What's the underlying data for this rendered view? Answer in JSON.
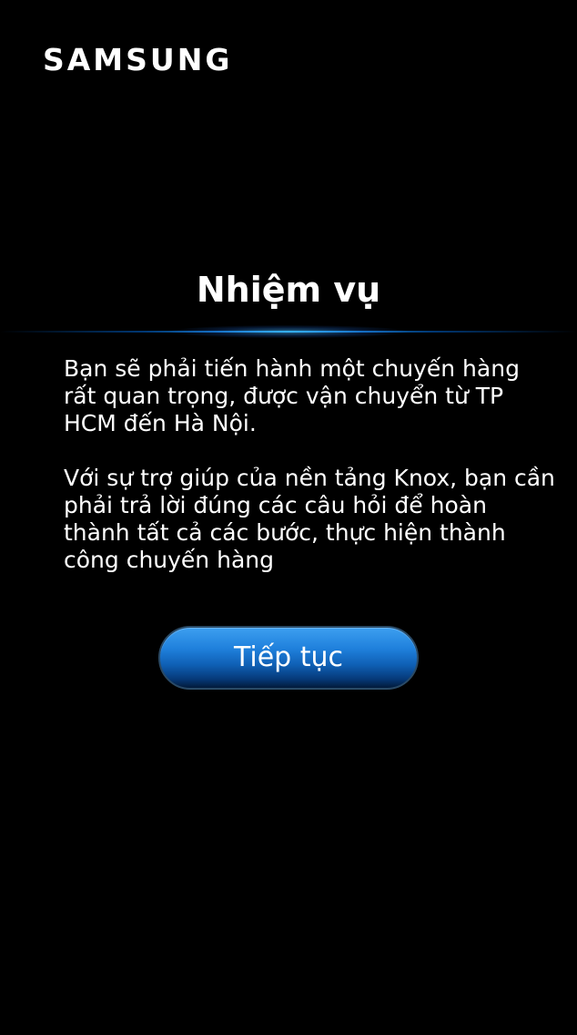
{
  "brand": {
    "logo_text": "SAMSUNG"
  },
  "heading": {
    "title": "Nhiệm vụ"
  },
  "content": {
    "paragraphs": [
      "Bạn sẽ phải tiến hành một chuyến hàng rất quan trọng, được vận chuyển từ TP HCM đến Hà Nội.",
      "Với sự trợ giúp của nền tảng Knox, bạn cần phải trả lời đúng các câu hỏi để hoàn thành tất cả các bước, thực hiện thành công chuyến hàng"
    ]
  },
  "actions": {
    "continue_label": "Tiếp tục"
  },
  "colors": {
    "background": "#000000",
    "text": "#ffffff",
    "accent_blue": "#1f80dc",
    "glow_blue": "#28aaff"
  }
}
